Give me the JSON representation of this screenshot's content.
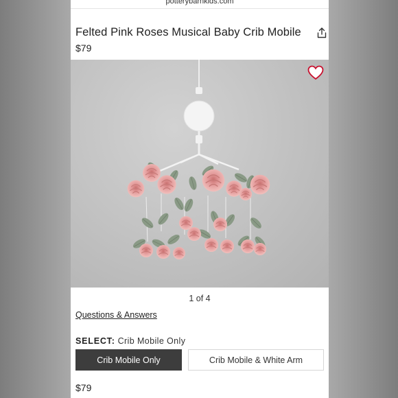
{
  "browser": {
    "url": "potterybarnkids.com"
  },
  "product": {
    "title": "Felted Pink Roses Musical Baby Crib Mobile",
    "price": "$79"
  },
  "gallery": {
    "counter": "1 of 4"
  },
  "links": {
    "questions_answers": "Questions & Answers"
  },
  "selection": {
    "label": "SELECT:",
    "current": "Crib Mobile Only",
    "options": [
      "Crib Mobile Only",
      "Crib Mobile & White Arm"
    ]
  },
  "footer": {
    "price": "$79"
  },
  "icons": {
    "share": "share-icon",
    "favorite": "heart-icon"
  },
  "colors": {
    "selected_option": "#3d3d3d",
    "rose": "#e39a9a",
    "leaf": "#8a9a86",
    "heart": "#c8102e"
  }
}
